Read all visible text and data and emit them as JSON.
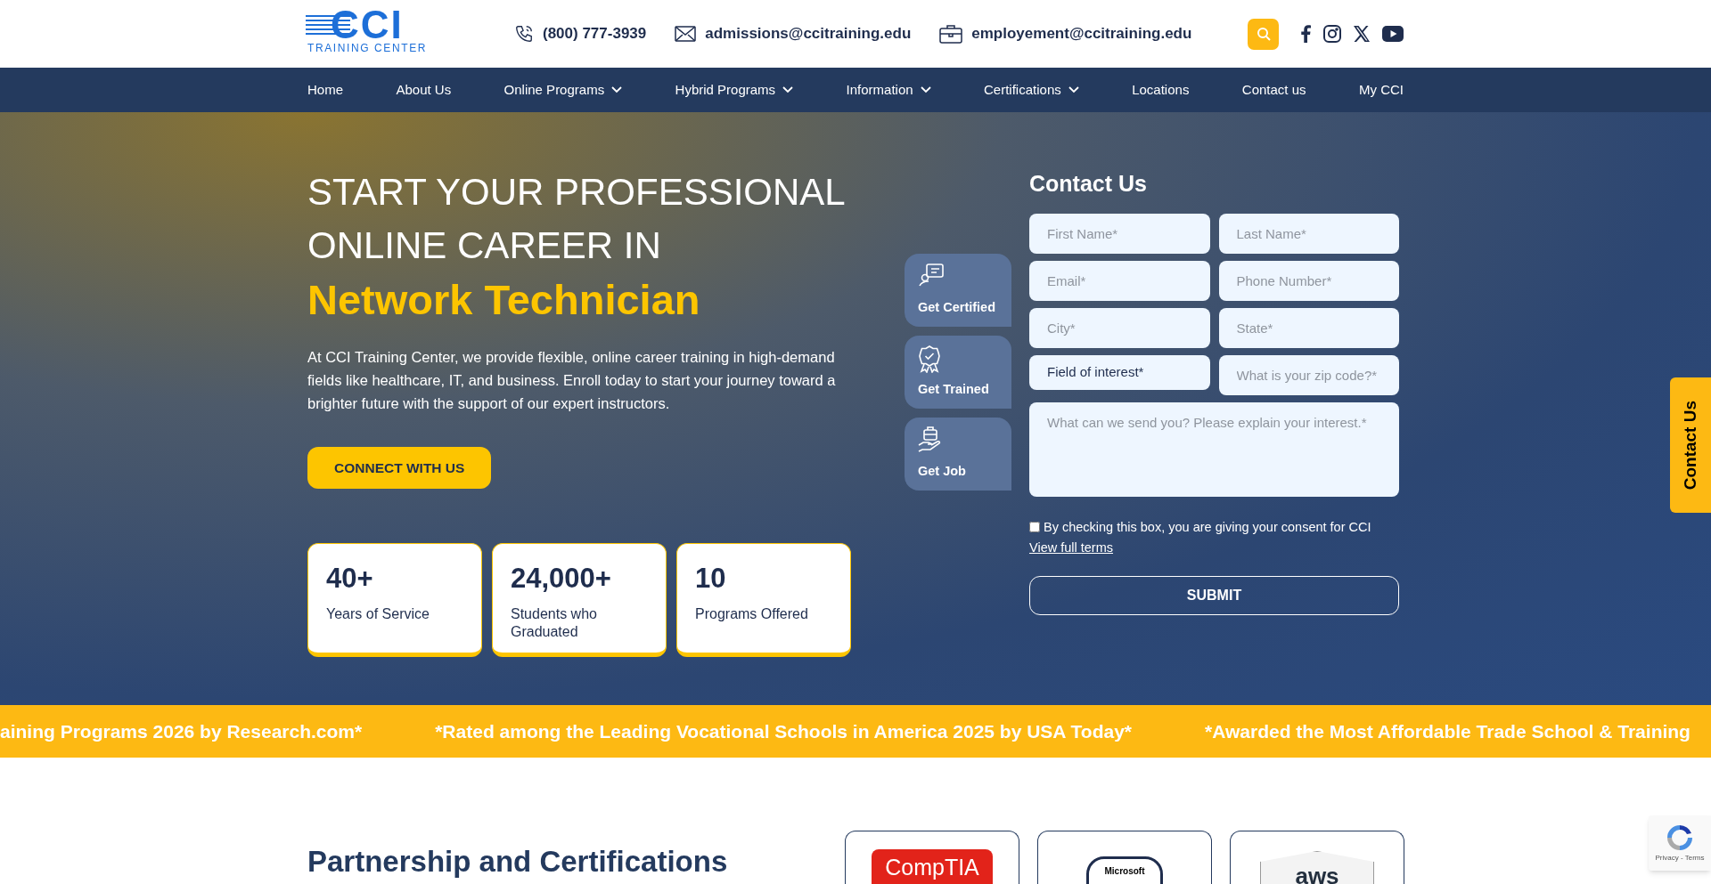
{
  "header": {
    "logo": {
      "word": "CCI",
      "tagline": "TRAINING CENTER"
    },
    "contacts": [
      {
        "kind": "phone",
        "text": "(800) 777-3939"
      },
      {
        "kind": "mail",
        "text": "admissions@ccitraining.edu"
      },
      {
        "kind": "briefcase",
        "text": "employement@ccitraining.edu"
      }
    ],
    "has_search": true
  },
  "nav": [
    {
      "label": "Home",
      "dropdown": false
    },
    {
      "label": "About Us",
      "dropdown": false
    },
    {
      "label": "Online Programs",
      "dropdown": true
    },
    {
      "label": "Hybrid Programs",
      "dropdown": true
    },
    {
      "label": "Information",
      "dropdown": true
    },
    {
      "label": "Certifications",
      "dropdown": true
    },
    {
      "label": "Locations",
      "dropdown": false
    },
    {
      "label": "Contact us",
      "dropdown": false
    },
    {
      "label": "My CCI",
      "dropdown": false
    }
  ],
  "hero": {
    "heading_lines": [
      "START YOUR PROFESSIONAL",
      "ONLINE CAREER IN"
    ],
    "highlight": "Network Technician",
    "text": "At CCI Training Center, we provide flexible, online career training in high-demand fields like healthcare, IT, and business. Enroll today to start your journey toward a brighter future with the support of our expert instructors.",
    "button": "CONNECT WITH US",
    "stats": [
      {
        "value": "40+",
        "label": "Years of Service"
      },
      {
        "value": "24,000+",
        "label": "Students who Graduated"
      },
      {
        "value": "10",
        "label": "Programs Offered"
      }
    ]
  },
  "steps": [
    {
      "kind": "certified",
      "label": "Get Certified"
    },
    {
      "kind": "trained",
      "label": "Get Trained"
    },
    {
      "kind": "job",
      "label": "Get Job"
    }
  ],
  "form": {
    "title": "Contact Us",
    "fields": [
      {
        "kind": "input",
        "placeholder": "First Name*"
      },
      {
        "kind": "input",
        "placeholder": "Last Name*"
      },
      {
        "kind": "input",
        "placeholder": "Email*"
      },
      {
        "kind": "input",
        "placeholder": "Phone Number*"
      },
      {
        "kind": "input",
        "placeholder": "City*"
      },
      {
        "kind": "input",
        "placeholder": "State*"
      },
      {
        "kind": "select",
        "value": "Field of interest*"
      },
      {
        "kind": "input",
        "placeholder": "What is your zip code?*"
      },
      {
        "kind": "textarea",
        "placeholder": "What can we send you? Please explain your interest.*"
      }
    ],
    "consent": {
      "text": "By checking this box, you are giving your consent for CCI",
      "checked": false,
      "link": "View full terms"
    },
    "submit": "SUBMIT"
  },
  "side_tab": "Contact Us",
  "ticker": [
    "aining Programs 2026 by Research.com*",
    "*Rated among the Leading Vocational Schools in America 2025 by USA Today*",
    "*Awarded the Most Affordable Trade School & Training"
  ],
  "partners": {
    "title": "Partnership and Certifications",
    "logos": [
      {
        "kind": "comptia",
        "text": "CompTIA"
      },
      {
        "kind": "microsoft",
        "text": "Microsoft"
      },
      {
        "kind": "aws",
        "text": "aws"
      }
    ]
  },
  "recaptcha": "Privacy - Terms"
}
